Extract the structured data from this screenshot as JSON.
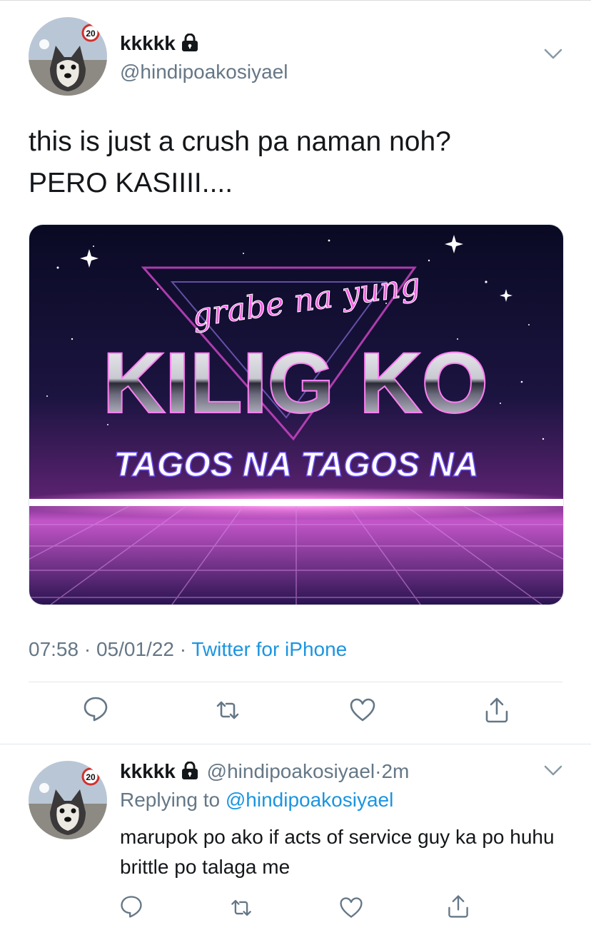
{
  "tweet": {
    "author": {
      "name": "kkkkk",
      "handle": "@hindipoakosiyael",
      "avatar_badge": "20"
    },
    "text_line1": "this is just a crush pa naman noh?",
    "text_line2": "PERO KASIIII....",
    "image": {
      "script_text": "grabe na yung",
      "main_text": "KILIG KO",
      "sub_text": "TAGOS NA TAGOS NA"
    },
    "time": "07:58",
    "date": "05/01/22",
    "sep": "·",
    "source": "Twitter for iPhone",
    "actions": [
      "reply-icon",
      "retweet-icon",
      "like-icon",
      "share-icon"
    ]
  },
  "reply": {
    "author": {
      "name": "kkkkk",
      "handle": "@hindipoakosiyael",
      "age": "2m",
      "avatar_badge": "20"
    },
    "replying_prefix": "Replying to",
    "replying_to": "@hindipoakosiyael",
    "text": "marupok po ako if acts of service guy ka po huhu brittle po talaga me",
    "actions": [
      "reply-icon",
      "retweet-icon",
      "like-icon",
      "share-icon"
    ]
  },
  "colors": {
    "text": "#14171a",
    "secondary": "#657786",
    "link": "#1b95e0",
    "divider": "#e1e8ed"
  }
}
